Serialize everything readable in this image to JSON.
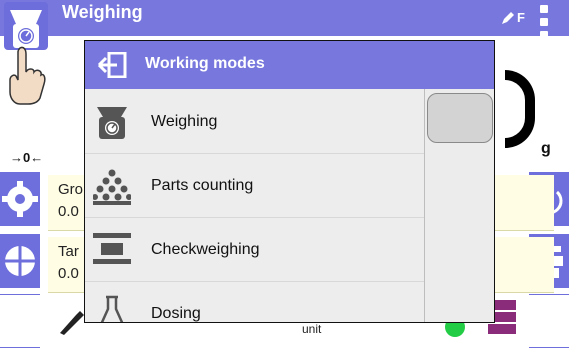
{
  "header": {
    "title": "Weighing",
    "status_text": "F",
    "app_icon": "weighing-mode-icon",
    "status_icon": "pen-icon",
    "menu_icon": "vertical-dots-icon"
  },
  "display": {
    "zero_indicator": "→0←",
    "unit": "g"
  },
  "info_panels": [
    {
      "label": "Gro",
      "value": "0.0"
    },
    {
      "label": "Tar",
      "value": "0.0"
    }
  ],
  "dialog": {
    "title": "Working modes",
    "back_icon": "exit-door-icon",
    "modes": [
      {
        "label": "Weighing",
        "icon": "scale-icon"
      },
      {
        "label": "Parts counting",
        "icon": "parts-counting-icon"
      },
      {
        "label": "Checkweighing",
        "icon": "checkweighing-icon"
      },
      {
        "label": "Dosing",
        "icon": "dosing-icon"
      }
    ]
  },
  "bottom": {
    "unit_shortcut": "unit"
  },
  "colors": {
    "accent": "#7777dd",
    "panel": "#fffde4",
    "dialog_bg": "#ededee"
  }
}
